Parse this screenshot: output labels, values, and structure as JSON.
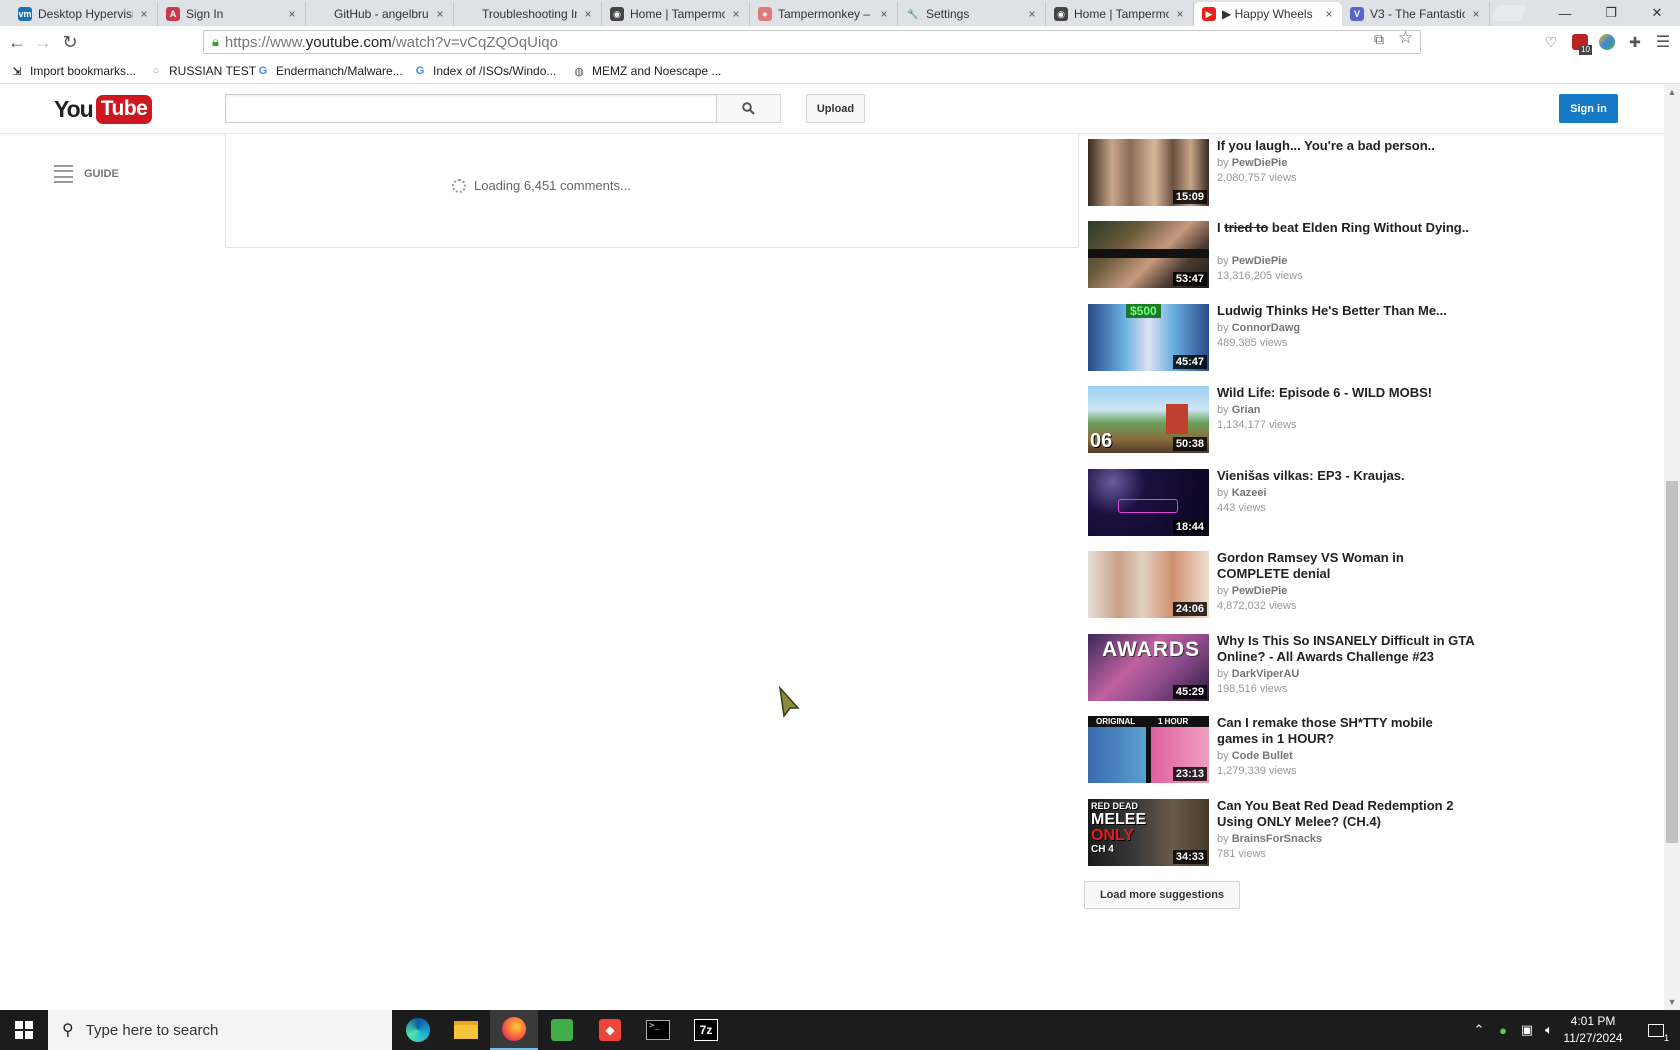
{
  "browser": {
    "tabs": [
      {
        "title": "Desktop Hypervisi",
        "fav_color": "#1a73b5",
        "fav_text": "vm"
      },
      {
        "title": "Sign In",
        "fav_color": "#c73a4a",
        "fav_text": "A"
      },
      {
        "title": "GitHub - angelbru",
        "fav_color": "#dee1e6",
        "fav_text": ""
      },
      {
        "title": "Troubleshooting Info",
        "fav_color": "#dee1e6",
        "fav_text": ""
      },
      {
        "title": "Home | Tampermo",
        "fav_color": "#444444",
        "fav_text": "◉"
      },
      {
        "title": "Tampermonkey –",
        "fav_color": "#e07a7a",
        "fav_text": "●"
      },
      {
        "title": "Settings",
        "fav_color": "#dee1e6",
        "fav_text": "🔧"
      },
      {
        "title": "Home | Tampermo",
        "fav_color": "#444444",
        "fav_text": "◉"
      },
      {
        "title": "▶ Happy Wheels",
        "fav_color": "#e62117",
        "fav_text": "▶"
      },
      {
        "title": "V3 - The Fantastic",
        "fav_color": "#5865c9",
        "fav_text": "V"
      }
    ],
    "tab_close": "×",
    "url_scheme": "https://www.",
    "url_host": "youtube.com",
    "url_path": "/watch?v=vCqZQOqUiqo",
    "bookmarks": [
      {
        "label": "Import bookmarks...",
        "icon": "import-icon"
      },
      {
        "label": "RUSSIAN TEST",
        "icon": "user-icon"
      },
      {
        "label": "Endermanch/Malware...",
        "icon": "google-icon"
      },
      {
        "label": "Index of /ISOs/Windo...",
        "icon": "google-icon"
      },
      {
        "label": "MEMZ and Noescape ...",
        "icon": "globe-icon"
      }
    ]
  },
  "youtube": {
    "logo_you": "You",
    "logo_tube": "Tube",
    "search_placeholder": "",
    "upload_label": "Upload",
    "signin_label": "Sign in",
    "guide_label": "GUIDE",
    "comments_loading": "Loading 6,451 comments...",
    "by_prefix": "by",
    "load_more_label": "Load more suggestions",
    "suggestions": [
      {
        "title": "If you laugh... You're a bad person..",
        "channel": "PewDiePie",
        "views": "2,080,757 views",
        "duration": "15:09",
        "thumb_color": "#8a6a55"
      },
      {
        "title_strike": "tried to",
        "title_pre": "I ",
        "title_post": " beat Elden Ring Without Dying..",
        "channel": "PewDiePie",
        "views": "13,316,205 views",
        "duration": "53:47",
        "thumb_color": "#5a4a3a"
      },
      {
        "title": "Ludwig Thinks He's Better Than Me...",
        "channel": "ConnorDawg",
        "views": "489,385 views",
        "duration": "45:47",
        "thumb_color": "#3a6aa0"
      },
      {
        "title": "Wild Life: Episode 6 - WILD MOBS!",
        "channel": "Grian",
        "views": "1,134,177 views",
        "duration": "50:38",
        "thumb_color": "#6a9a6a"
      },
      {
        "title": "Vienišas vilkas: EP3 - Kraujas.",
        "channel": "Kazeei",
        "views": "443 views",
        "duration": "18:44",
        "thumb_color": "#1a1040"
      },
      {
        "title": "Gordon Ramsey VS Woman in COMPLETE denial",
        "channel": "PewDiePie",
        "views": "4,872,032 views",
        "duration": "24:06",
        "thumb_color": "#d9c4b0"
      },
      {
        "title": "Why Is This So INSANELY Difficult in GTA Online? - All Awards Challenge #23",
        "channel": "DarkViperAU",
        "views": "198,516 views",
        "duration": "45:29",
        "thumb_color": "#a05a8a"
      },
      {
        "title": "Can I remake those SH*TTY mobile games in 1 HOUR?",
        "channel": "Code Bullet",
        "views": "1,279,339 views",
        "duration": "23:13",
        "thumb_color": "#5aa0d0"
      },
      {
        "title": "Can You Beat Red Dead Redemption 2 Using ONLY Melee? (CH.4)",
        "channel": "BrainsForSnacks",
        "views": "781 views",
        "duration": "34:33",
        "thumb_color": "#4a3a2a"
      }
    ],
    "thumb_overlays": {
      "ludwig_price": "$500",
      "wild_badge": "06",
      "awards_text": "AWARDS",
      "code_bullet_left": "ORIGINAL",
      "code_bullet_right": "1 HOUR",
      "rdr_line1": "RED DEAD",
      "rdr_line2": "MELEE",
      "rdr_line3": "ONLY",
      "rdr_line4": "CH 4"
    }
  },
  "taskbar": {
    "search_placeholder": "Type here to search",
    "time": "4:01 PM",
    "date": "11/27/2024",
    "notification_count": "1",
    "ublock_badge": "10"
  }
}
